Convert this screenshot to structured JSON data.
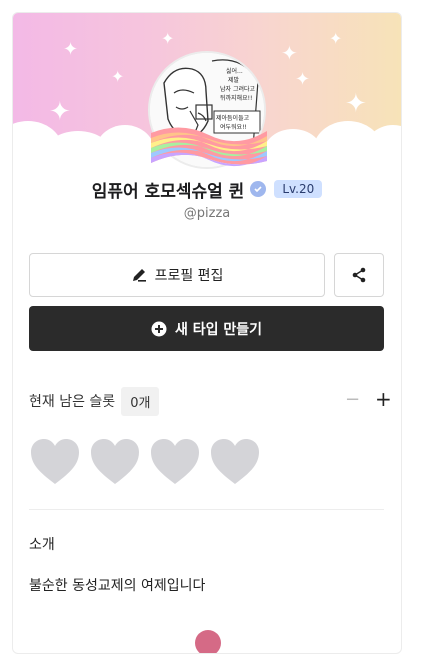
{
  "profile": {
    "name": "임퓨어 호모섹슈얼 퀸",
    "level": "Lv.20",
    "handle": "@pizza",
    "avatar_text": [
      "싫어...",
      "제발",
      "남자 그려다고",
      "뒤까지해요!!",
      "제아듬이들고",
      "여두워요!!"
    ]
  },
  "actions": {
    "edit_label": "프로필 편집",
    "new_type_label": "새 타입 만들기"
  },
  "slots": {
    "label": "현재 남은 슬롯",
    "count": "0개",
    "minus": "−",
    "plus": "+"
  },
  "intro": {
    "title": "소개",
    "text": "불순한 동성교제의 여제입니다"
  },
  "colors": {
    "banner_pink": "#f3b9e6",
    "banner_yellow": "#f7e3b8",
    "level_badge": "#cfe0ff",
    "primary_button": "#2b2b2b",
    "heart": "#d4d4d8"
  }
}
